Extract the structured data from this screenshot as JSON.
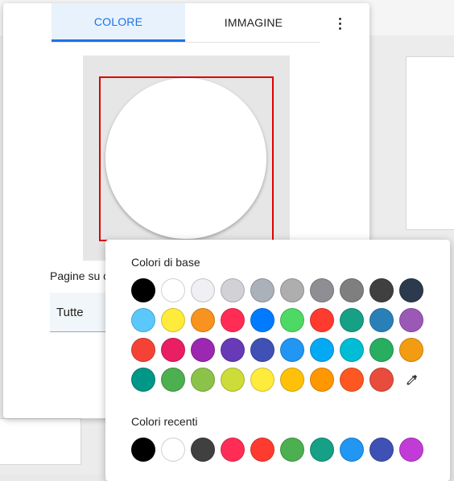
{
  "tabs": [
    {
      "label": "COLORE",
      "active": true
    },
    {
      "label": "IMMAGINE",
      "active": false
    }
  ],
  "pages": {
    "label": "Pagine su c",
    "value": "Tutte"
  },
  "popup": {
    "base_title": "Colori di base",
    "recent_title": "Colori recenti",
    "base_rows": [
      [
        "#000000",
        "#ffffff",
        "#efeff4",
        "#d1d1d6",
        "#aab1b9",
        "#aeaeae",
        "#8e8e93",
        "#7f7f7f",
        "#404040",
        "#2b3a4d"
      ],
      [
        "#5ac8fa",
        "#ffeb3b",
        "#f7931e",
        "#ff2d55",
        "#007aff",
        "#4cd964",
        "#ff3b30",
        "#16a085",
        "#2980b9",
        "#9b59b6"
      ],
      [
        "#f44336",
        "#e91e63",
        "#9c27b0",
        "#673ab7",
        "#3f51b5",
        "#2196f3",
        "#03a9f4",
        "#00bcd4",
        "#27ae60",
        "#f39c12"
      ],
      [
        "#009688",
        "#4caf50",
        "#8bc34a",
        "#cddc39",
        "#ffeb3b",
        "#ffc107",
        "#ff9800",
        "#ff5722",
        "#e74c3c"
      ]
    ],
    "recent": [
      "#000000",
      "#ffffff",
      "#404040",
      "#ff2d55",
      "#ff3b30",
      "#4caf50",
      "#16a085",
      "#2196f3",
      "#3f51b5",
      "#c13cd6"
    ]
  }
}
